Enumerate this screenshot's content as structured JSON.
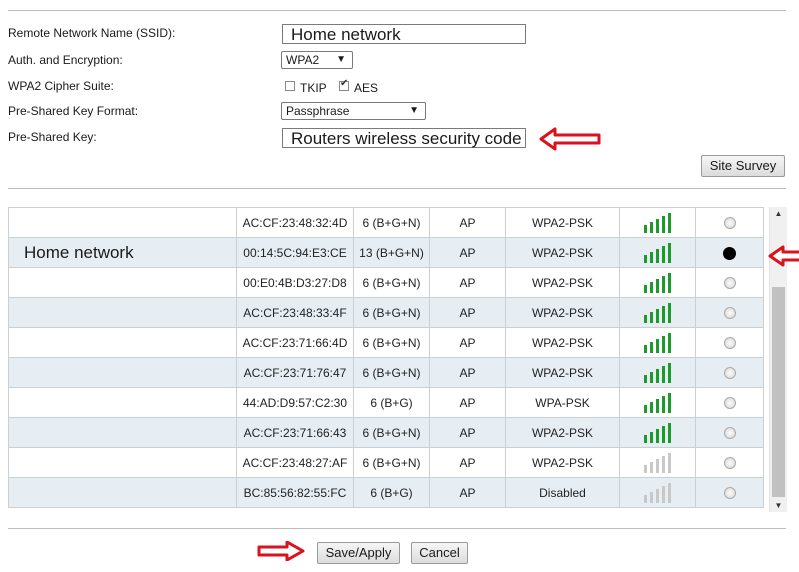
{
  "form": {
    "ssid_label": "Remote Network Name (SSID):",
    "ssid_value": "Home network",
    "auth_label": "Auth. and Encryption:",
    "auth_value": "WPA2",
    "cipher_label": "WPA2 Cipher Suite:",
    "cipher_tkip": "TKIP",
    "cipher_aes": "AES",
    "psk_format_label": "Pre-Shared Key Format:",
    "psk_format_value": "Passphrase",
    "psk_label": "Pre-Shared Key:",
    "psk_value": "Routers wireless security code"
  },
  "site_survey_button": "Site Survey",
  "selected_network_label": "Home network",
  "networks": [
    {
      "mac": "AC:CF:23:48:32:4D",
      "channel": "6 (B+G+N)",
      "mode": "AP",
      "security": "WPA2-PSK",
      "signal": "strong",
      "selected": false
    },
    {
      "mac": "00:14:5C:94:E3:CE",
      "channel": "13 (B+G+N)",
      "mode": "AP",
      "security": "WPA2-PSK",
      "signal": "strong",
      "selected": true
    },
    {
      "mac": "00:E0:4B:D3:27:D8",
      "channel": "6 (B+G+N)",
      "mode": "AP",
      "security": "WPA2-PSK",
      "signal": "strong",
      "selected": false
    },
    {
      "mac": "AC:CF:23:48:33:4F",
      "channel": "6 (B+G+N)",
      "mode": "AP",
      "security": "WPA2-PSK",
      "signal": "strong",
      "selected": false
    },
    {
      "mac": "AC:CF:23:71:66:4D",
      "channel": "6 (B+G+N)",
      "mode": "AP",
      "security": "WPA2-PSK",
      "signal": "strong",
      "selected": false
    },
    {
      "mac": "AC:CF:23:71:76:47",
      "channel": "6 (B+G+N)",
      "mode": "AP",
      "security": "WPA2-PSK",
      "signal": "strong",
      "selected": false
    },
    {
      "mac": "44:AD:D9:57:C2:30",
      "channel": "6 (B+G)",
      "mode": "AP",
      "security": "WPA-PSK",
      "signal": "strong",
      "selected": false
    },
    {
      "mac": "AC:CF:23:71:66:43",
      "channel": "6 (B+G+N)",
      "mode": "AP",
      "security": "WPA2-PSK",
      "signal": "strong",
      "selected": false
    },
    {
      "mac": "AC:CF:23:48:27:AF",
      "channel": "6 (B+G+N)",
      "mode": "AP",
      "security": "WPA2-PSK",
      "signal": "weak",
      "selected": false
    },
    {
      "mac": "BC:85:56:82:55:FC",
      "channel": "6 (B+G)",
      "mode": "AP",
      "security": "Disabled",
      "signal": "weak",
      "selected": false
    }
  ],
  "buttons": {
    "save": "Save/Apply",
    "cancel": "Cancel"
  },
  "colors": {
    "signal_strong": "#1c9a2c",
    "signal_weak": "#c8c8c8",
    "annotation_arrow": "#d9121b",
    "row_alt": "#e6eef4"
  },
  "icons": {
    "annotation": "red-arrow-icon",
    "signal": "signal-bars-icon",
    "radio": "radio-button-icon"
  }
}
